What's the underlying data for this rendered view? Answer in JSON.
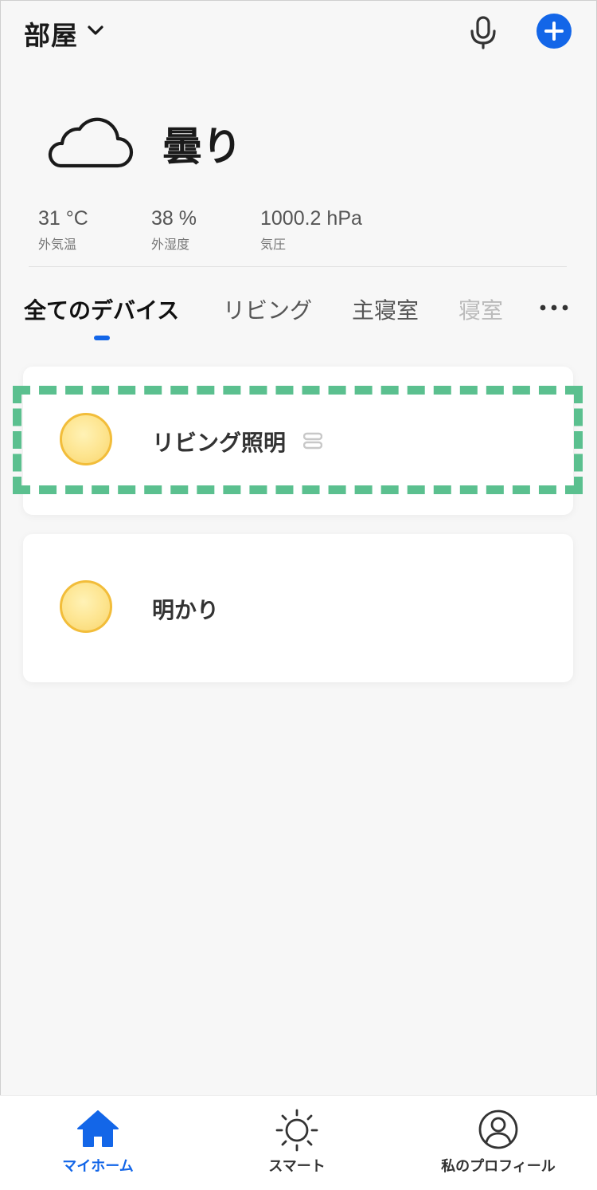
{
  "header": {
    "room_title": "部屋",
    "accent_color": "#1366e8"
  },
  "weather": {
    "condition": "曇り",
    "icon": "cloud-icon",
    "stats": [
      {
        "value": "31 °C",
        "label": "外気温"
      },
      {
        "value": "38 %",
        "label": "外湿度"
      },
      {
        "value": "1000.2 hPa",
        "label": "気圧"
      }
    ]
  },
  "tabs": [
    {
      "label": "全てのデバイス",
      "active": true
    },
    {
      "label": "リビング"
    },
    {
      "label": "主寝室"
    },
    {
      "label": "寝室"
    }
  ],
  "devices": [
    {
      "name": "リビング照明",
      "icon": "bulb-icon",
      "linked": true
    },
    {
      "name": "明かり",
      "icon": "bulb-icon"
    }
  ],
  "bottom_nav": [
    {
      "label": "マイホーム",
      "icon": "home-icon",
      "active": true
    },
    {
      "label": "スマート",
      "icon": "sun-icon"
    },
    {
      "label": "私のプロフィール",
      "icon": "profile-icon"
    }
  ]
}
